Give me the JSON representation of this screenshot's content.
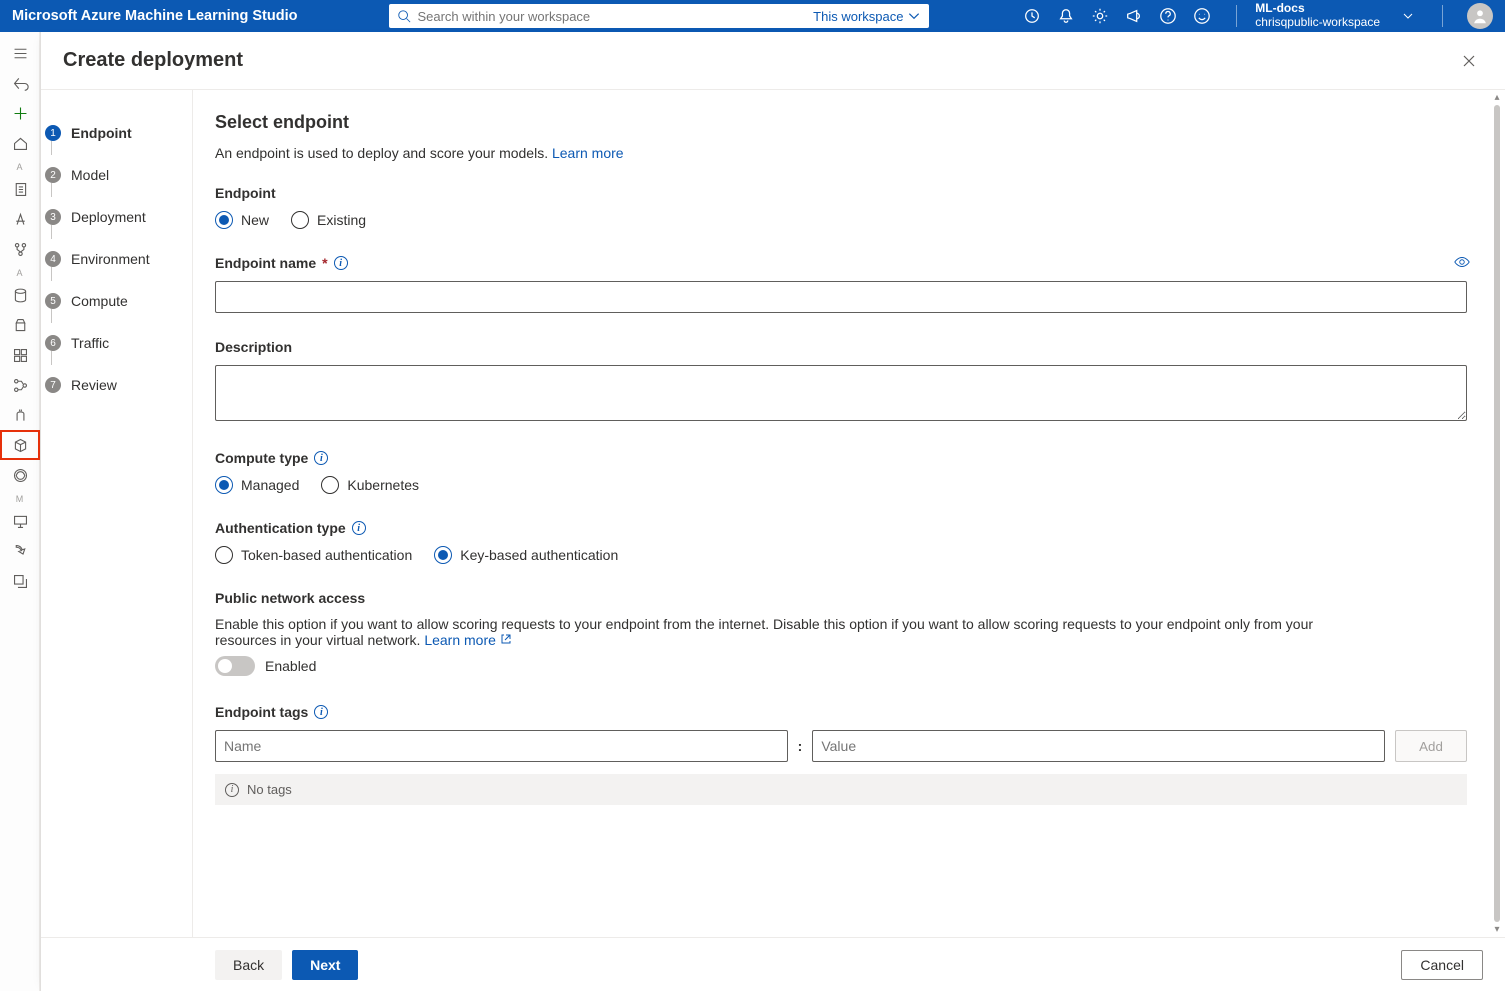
{
  "header": {
    "brand": "Microsoft Azure Machine Learning Studio",
    "search_placeholder": "Search within your workspace",
    "scope_label": "This workspace",
    "workspace_name": "ML-docs",
    "workspace_sub": "chrisqpublic-workspace"
  },
  "rail": {
    "section_a": "A",
    "section_a2": "A",
    "section_m": "M"
  },
  "dialog": {
    "title": "Create deployment",
    "steps": [
      {
        "n": "1",
        "label": "Endpoint",
        "state": "current"
      },
      {
        "n": "2",
        "label": "Model",
        "state": ""
      },
      {
        "n": "3",
        "label": "Deployment",
        "state": ""
      },
      {
        "n": "4",
        "label": "Environment",
        "state": ""
      },
      {
        "n": "5",
        "label": "Compute",
        "state": ""
      },
      {
        "n": "6",
        "label": "Traffic",
        "state": ""
      },
      {
        "n": "7",
        "label": "Review",
        "state": ""
      }
    ],
    "h2": "Select endpoint",
    "desc_text": "An endpoint is used to deploy and score your models. ",
    "desc_link": "Learn more",
    "endpoint_section_label": "Endpoint",
    "endpoint_radio_new": "New",
    "endpoint_radio_existing": "Existing",
    "endpoint_name_label": "Endpoint name",
    "endpoint_name_value": "",
    "description_label": "Description",
    "description_value": "",
    "compute_type_label": "Compute type",
    "compute_radio_managed": "Managed",
    "compute_radio_k8s": "Kubernetes",
    "auth_type_label": "Authentication type",
    "auth_radio_token": "Token-based authentication",
    "auth_radio_key": "Key-based authentication",
    "public_access_label": "Public network access",
    "public_access_desc": "Enable this option if you want to allow scoring requests to your endpoint from the internet. Disable this option if you want to allow scoring requests to your endpoint only from your resources in your virtual network. ",
    "public_access_link": "Learn more",
    "public_access_toggle_text": "Enabled",
    "endpoint_tags_label": "Endpoint tags",
    "tag_name_placeholder": "Name",
    "tag_value_placeholder": "Value",
    "tag_add_label": "Add",
    "no_tags_text": "No tags",
    "footer_back": "Back",
    "footer_next": "Next",
    "footer_cancel": "Cancel"
  }
}
